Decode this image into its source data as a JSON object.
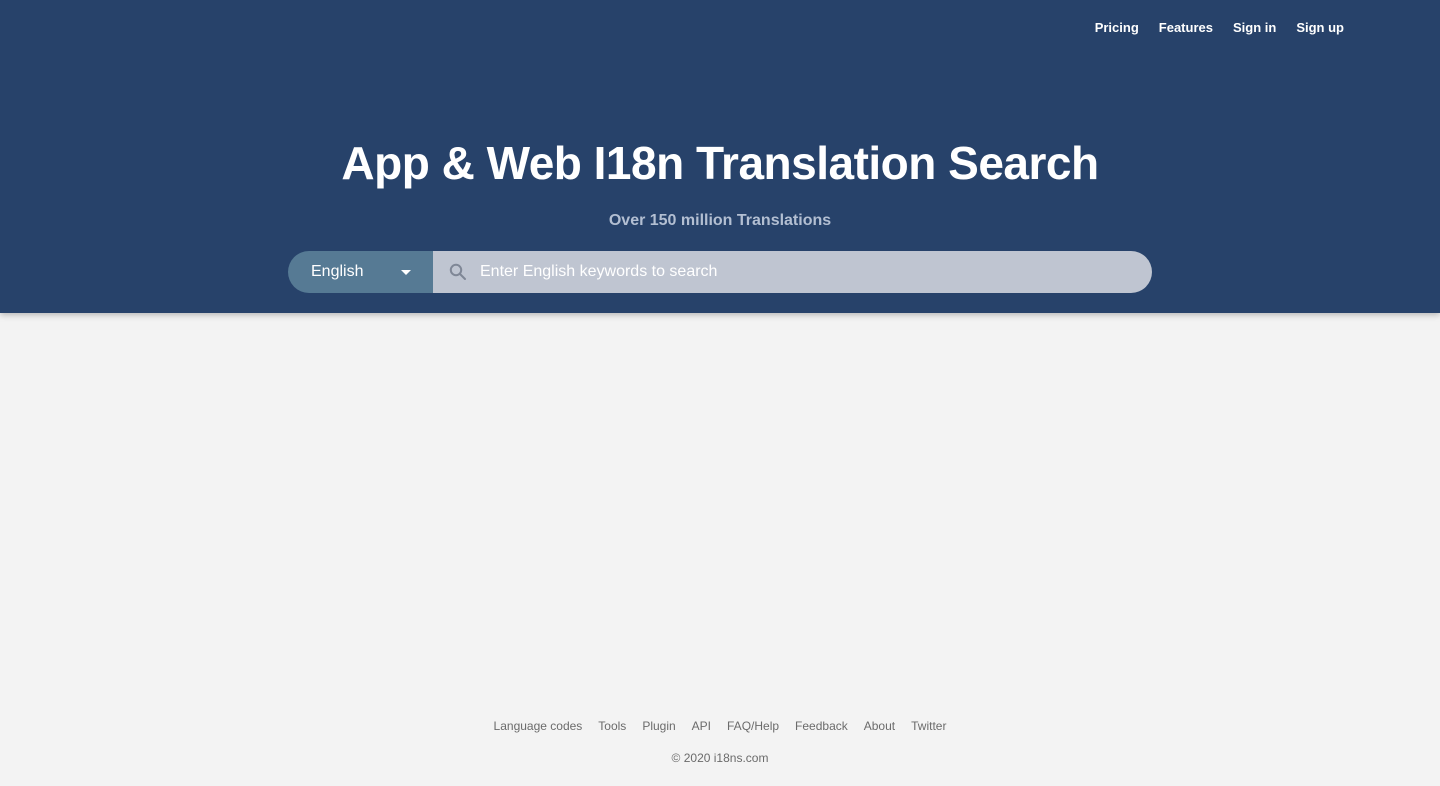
{
  "nav": {
    "items": [
      {
        "label": "Pricing"
      },
      {
        "label": "Features"
      },
      {
        "label": "Sign in"
      },
      {
        "label": "Sign up"
      }
    ]
  },
  "hero": {
    "title": "App & Web I18n Translation Search",
    "subtitle": "Over 150 million Translations"
  },
  "search": {
    "language": "English",
    "placeholder": "Enter English keywords to search",
    "value": ""
  },
  "footer": {
    "links": [
      {
        "label": "Language codes"
      },
      {
        "label": "Tools"
      },
      {
        "label": "Plugin"
      },
      {
        "label": "API"
      },
      {
        "label": "FAQ/Help"
      },
      {
        "label": "Feedback"
      },
      {
        "label": "About"
      },
      {
        "label": "Twitter"
      }
    ],
    "copyright": "© 2020 i18ns.com"
  },
  "colors": {
    "header_bg": "#27426a",
    "language_select_bg": "#567a94",
    "search_bg": "#bfc5d1",
    "page_bg": "#f3f3f3"
  },
  "icons": {
    "search": "search-icon",
    "dropdown": "caret-down-icon"
  }
}
